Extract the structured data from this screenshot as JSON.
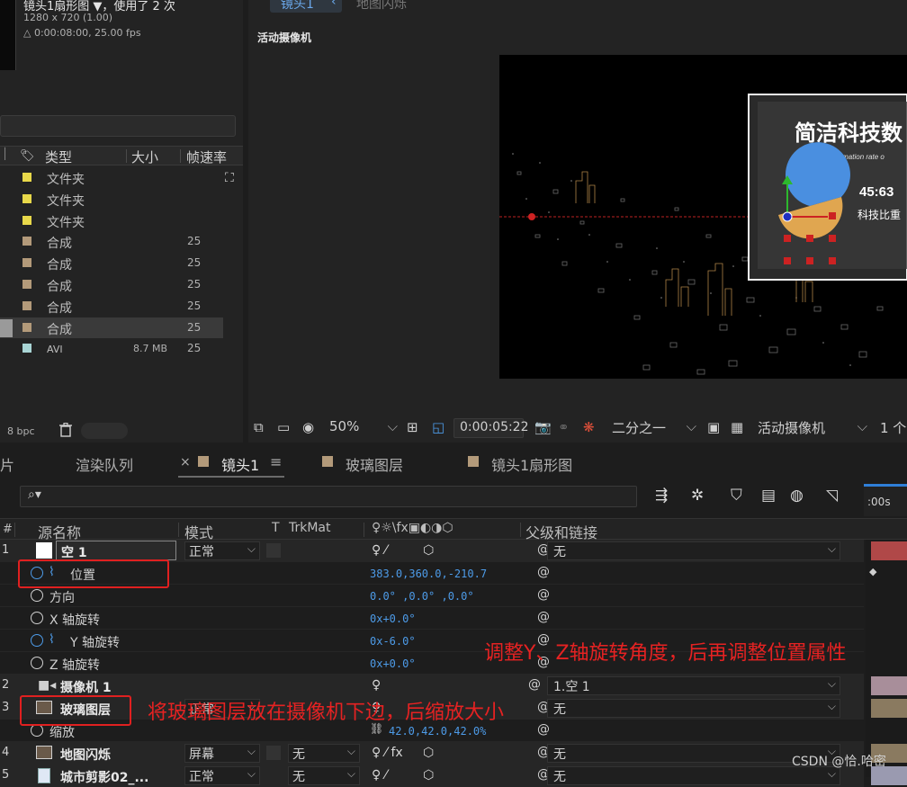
{
  "project": {
    "comp_name": "镜头1扇形图 ▼，使用了 2 次",
    "resolution": "1280 x 720 (1.00)",
    "duration": "△ 0:00:08:00, 25.00 fps",
    "columns": [
      "类型",
      "大小",
      "帧速率"
    ],
    "rows": [
      {
        "type": "文件夹",
        "size": "",
        "fps": "",
        "color": "#e8d84a"
      },
      {
        "type": "文件夹",
        "size": "",
        "fps": "",
        "color": "#e8d84a"
      },
      {
        "type": "文件夹",
        "size": "",
        "fps": "",
        "color": "#e8d84a"
      },
      {
        "type": "合成",
        "size": "",
        "fps": "25",
        "color": "#b39a7a"
      },
      {
        "type": "合成",
        "size": "",
        "fps": "25",
        "color": "#b39a7a"
      },
      {
        "type": "合成",
        "size": "",
        "fps": "25",
        "color": "#b39a7a"
      },
      {
        "type": "合成",
        "size": "",
        "fps": "25",
        "color": "#b39a7a"
      },
      {
        "type": "合成",
        "size": "",
        "fps": "25",
        "color": "#b39a7a"
      },
      {
        "type": "AVI",
        "size": "8.7 MB",
        "fps": "25",
        "color": "#a9d5d5"
      }
    ],
    "bpc": "8 bpc"
  },
  "viewer": {
    "tab_active": "镜头1",
    "tab_other": "地图闪烁",
    "title": "活动摄像机",
    "canvas_title": "简洁科技数",
    "canvas_subtitle": "The transformation rate o",
    "canvas_number": "45:63",
    "canvas_caption": "科技比重",
    "zoom": "50%",
    "timecode": "0:00:05:22",
    "resolution": "二分之一",
    "camera": "活动摄像机",
    "views": "1 个"
  },
  "timeline": {
    "tabs": [
      "片",
      "渲染队列",
      "镜头1",
      "玻璃图层",
      "镜头1扇形图"
    ],
    "close_mark": "×",
    "menu_mark": "≡",
    "search_placeholder": "⌕▾",
    "ruler_time": ":00s",
    "headers": {
      "num": "#",
      "source": "源名称",
      "mode": "模式",
      "t": "T",
      "trkmat": "TrkMat",
      "switches": "♀☼\\fx▣◐◑⬡",
      "parent": "父级和链接"
    }
  },
  "layers": {
    "l1": {
      "num": "1",
      "name": "空 1",
      "mode": "正常",
      "parent": "无"
    },
    "position": {
      "label": "位置",
      "value": "383.0,360.0,-210.7"
    },
    "orientation": {
      "label": "方向",
      "value": "0.0° ,0.0° ,0.0°"
    },
    "xrot": {
      "label": "X 轴旋转",
      "value": "0x+0.0°"
    },
    "yrot": {
      "label": "Y 轴旋转",
      "value": "0x-6.0°"
    },
    "zrot": {
      "label": "Z 轴旋转",
      "value": "0x+0.0°"
    },
    "l2": {
      "num": "2",
      "name": "摄像机 1",
      "parent": "1.空 1"
    },
    "l3": {
      "num": "3",
      "name": "玻璃图层",
      "mode": "正常",
      "parent": "无"
    },
    "scale": {
      "label": "缩放",
      "value": "42.0,42.0,42.0%"
    },
    "l4": {
      "num": "4",
      "name": "地图闪烁",
      "mode": "屏幕",
      "trk": "无",
      "parent": "无"
    },
    "l5": {
      "num": "5",
      "name": "城市剪影02_...",
      "mode": "正常",
      "trk": "无",
      "parent": "无"
    }
  },
  "annotations": {
    "note1": "调整Y、Z轴旋转角度，后再调整位置属性",
    "note2": "将玻璃图层放在摄像机下边，后缩放大小"
  },
  "watermark": "CSDN @恰.哈密",
  "colors": {
    "accent_blue": "#4d9be8",
    "annotation_red": "#e02020",
    "label_comp": "#b39a7a",
    "label_folder": "#e8d84a"
  }
}
